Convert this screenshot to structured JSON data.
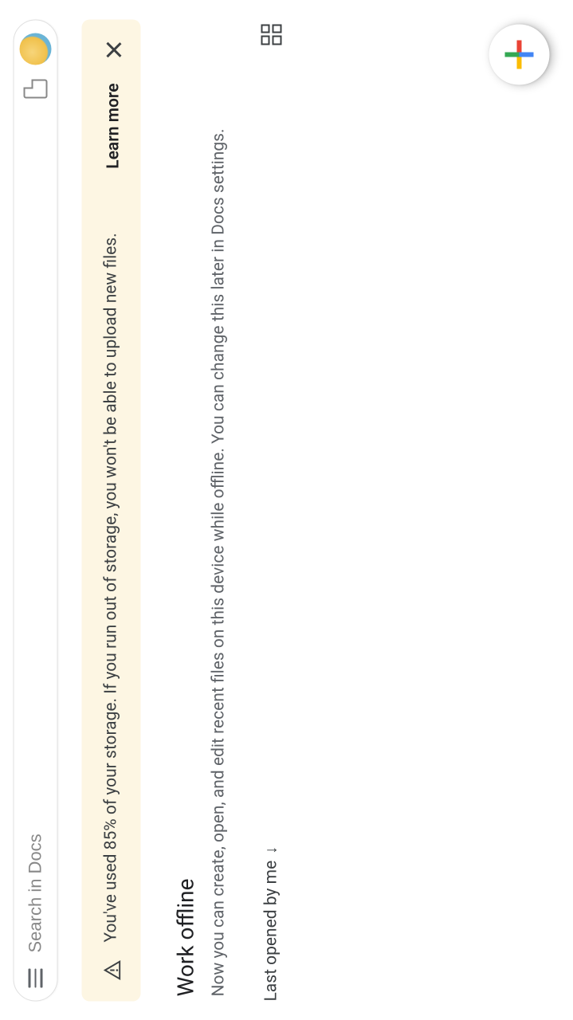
{
  "search": {
    "placeholder": "Search in Docs"
  },
  "banner": {
    "message": "You've used 85% of your storage. If you run out of storage, you won't be able to upload new files.",
    "learn_more": "Learn more"
  },
  "offline": {
    "title": "Work offline",
    "description": "Now you can create, open, and edit recent files on this device while offline. You can change this later in Docs settings."
  },
  "sort": {
    "label": "Last opened by me"
  }
}
